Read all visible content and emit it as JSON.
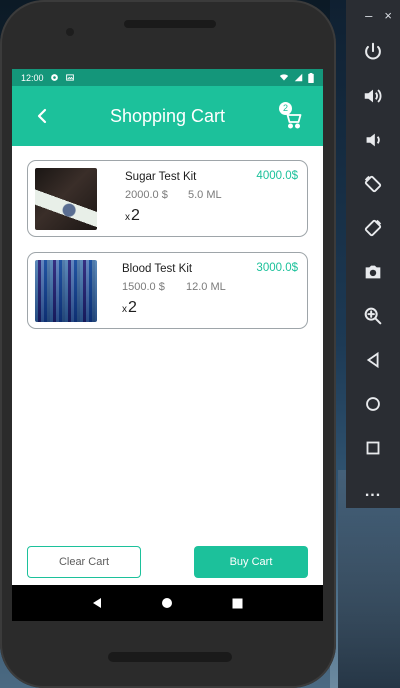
{
  "status_bar": {
    "time": "12:00"
  },
  "app_bar": {
    "title": "Shopping Cart",
    "cart_count": "2"
  },
  "cart": {
    "items": [
      {
        "name": "Sugar Test Kit",
        "price": "2000.0 $",
        "volume": "5.0 ML",
        "total": "4000.0$",
        "qty_prefix": "x",
        "qty": "2"
      },
      {
        "name": "Blood Test Kit",
        "price": "1500.0 $",
        "volume": "12.0 ML",
        "total": "3000.0$",
        "qty_prefix": "x",
        "qty": "2"
      }
    ]
  },
  "actions": {
    "clear_label": "Clear Cart",
    "buy_label": "Buy Cart"
  },
  "emulator_toolbar": {
    "minimize": "–",
    "close": "×",
    "more": "..."
  },
  "colors": {
    "accent": "#1cc19b",
    "status_bar": "#14967a"
  }
}
